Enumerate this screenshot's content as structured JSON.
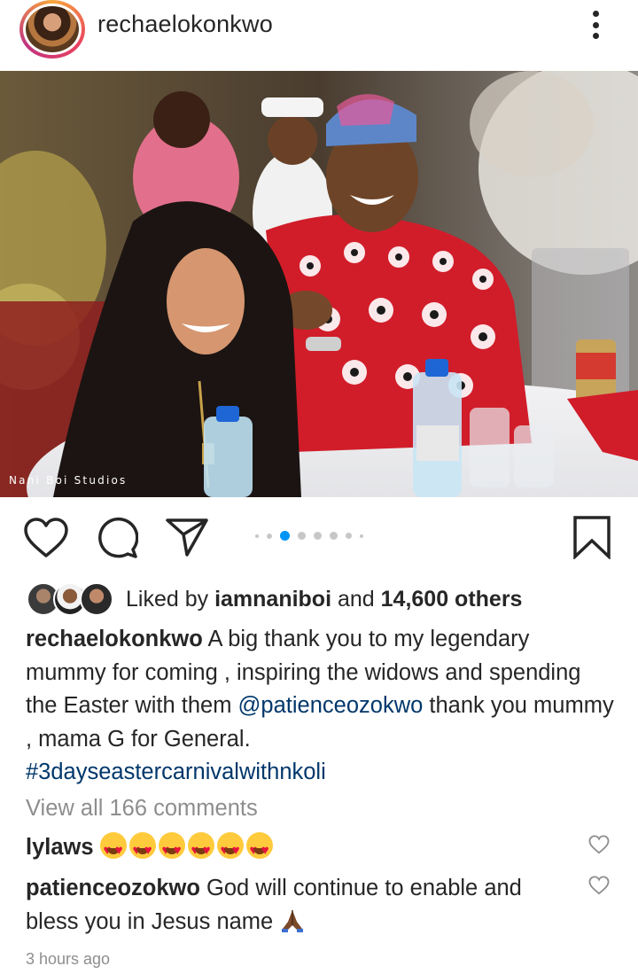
{
  "post": {
    "username": "rechaelokonkwo",
    "photo_watermark": "Nani Boi Studios",
    "carousel_total": 8,
    "carousel_active": 2
  },
  "likes": {
    "prefix": "Liked by ",
    "user": "iamnaniboi",
    "middle": " and ",
    "count": "14,600 others"
  },
  "caption": {
    "user": "rechaelokonkwo",
    "text1": " A big thank you to my legendary mummy for coming , inspiring the widows and spending the Easter with them ",
    "mention": "@patienceozokwo",
    "text2": " thank you mummy , mama G for General.",
    "hashtag": "#3dayseastercarnivalwithnkoli"
  },
  "view_comments": "View all 166 comments",
  "comments": [
    {
      "user": "lylaws",
      "text": "",
      "emoji_count": 6,
      "emoji": "smiling-face-with-heart-eyes"
    },
    {
      "user": "patienceozokwo",
      "text": " God will continue to enable and bless you in Jesus name ",
      "emoji": "folded-hands"
    }
  ],
  "timestamp": "3 hours ago",
  "colors": {
    "accent": "#0095f6",
    "link": "#00376b",
    "muted": "#8e8e8e",
    "text": "#262626"
  }
}
